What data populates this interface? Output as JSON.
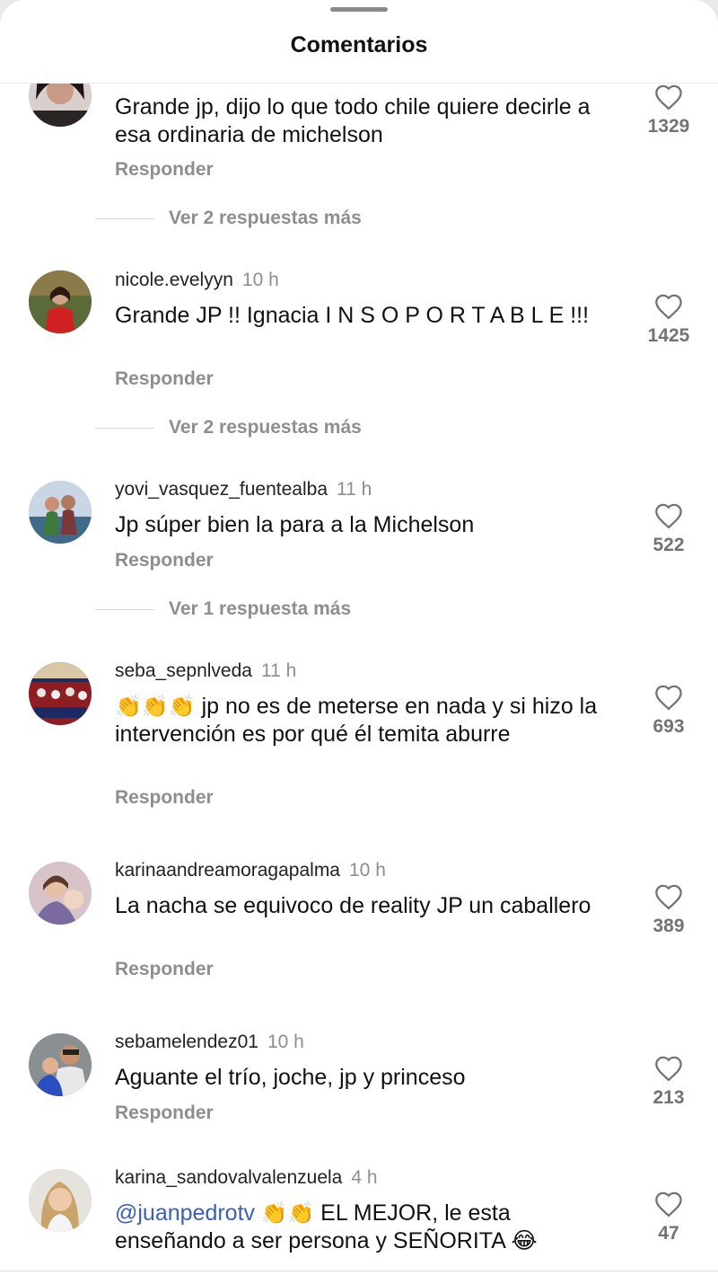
{
  "header": {
    "title": "Comentarios"
  },
  "comments": [
    {
      "user": "",
      "time": "",
      "text": "Grande jp, dijo lo que todo chile quiere decirle a esa ordinaria de michelson",
      "reply": "Responder",
      "likes": "1329",
      "more": "Ver 2 respuestas más"
    },
    {
      "user": "nicole.evelyyn",
      "time": "10 h",
      "text": "Grande JP !! Ignacia  I N S O P O R T A B L E !!!",
      "reply": "Responder",
      "likes": "1425",
      "more": "Ver 2 respuestas más"
    },
    {
      "user": "yovi_vasquez_fuentealba",
      "time": "11 h",
      "text": "Jp súper bien la para a la Michelson",
      "reply": "Responder",
      "likes": "522",
      "more": "Ver 1 respuesta más"
    },
    {
      "user": "seba_sepnlveda",
      "time": "11 h",
      "emoji": "👏👏👏",
      "text": " jp no es de meterse en nada y si hizo la intervención es por qué él temita aburre",
      "reply": "Responder",
      "likes": "693"
    },
    {
      "user": "karinaandreamoragapalma",
      "time": "10 h",
      "text": "La nacha se equivoco de reality JP un caballero",
      "reply": "Responder",
      "likes": "389"
    },
    {
      "user": "sebamelendez01",
      "time": "10 h",
      "text": "Aguante el trío, joche, jp y princeso",
      "reply": "Responder",
      "likes": "213"
    },
    {
      "user": "karina_sandovalvalenzuela",
      "time": "4 h",
      "mention": "@juanpedrotv",
      "emoji": " 👏👏 ",
      "text": "EL MEJOR, le esta enseñando a ser persona y SEÑORITA 😂",
      "reply": "Responder",
      "likes": "47"
    }
  ],
  "colors": {
    "mention": "#3c5fb5",
    "muted": "#8e8e8e",
    "text": "#111111"
  },
  "icons": {
    "like": "heart-outline-icon"
  }
}
